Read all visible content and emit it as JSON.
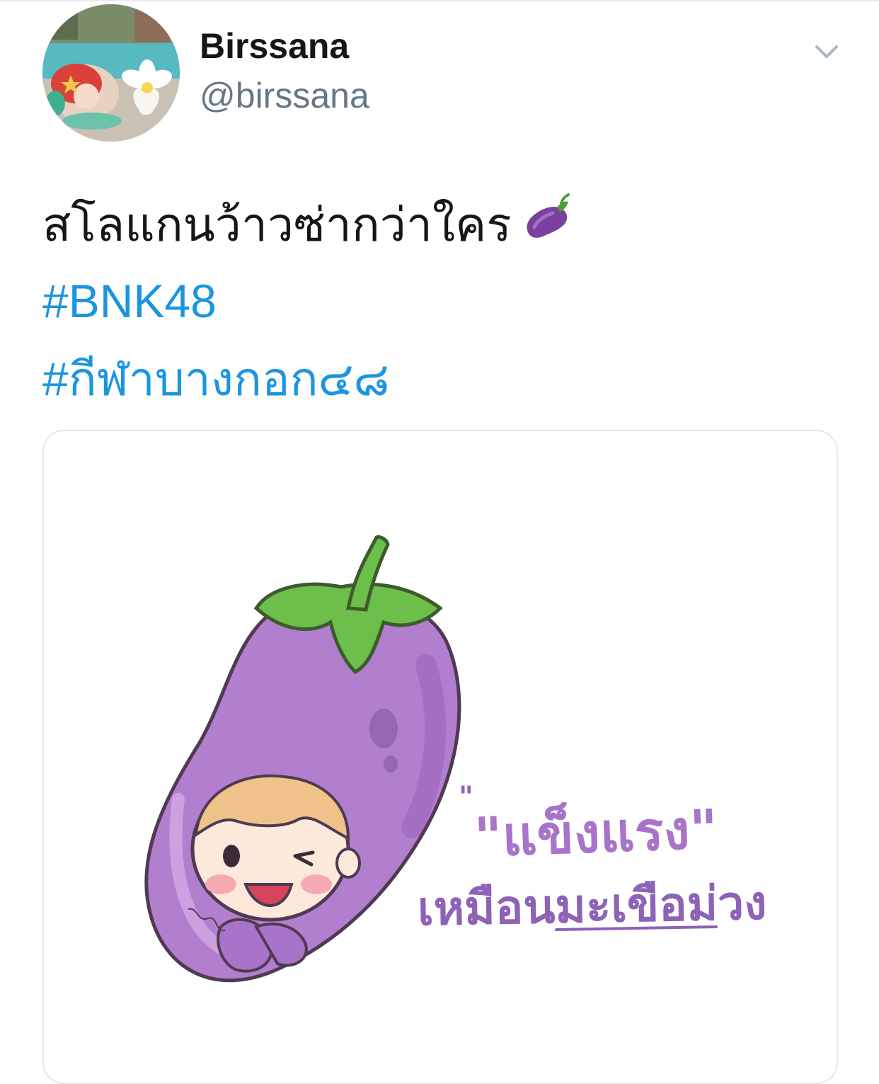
{
  "tweet": {
    "author": {
      "display_name": "Birssana",
      "handle": "@birssana",
      "avatar_icon": "avatar-photo-mermaid-plush"
    },
    "menu_icon": "chevron-down-icon",
    "text": "สโลแกนว้าวซ่ากว่าใคร",
    "text_emoji": "eggplant-emoji",
    "hashtags": [
      "#BNK48",
      "#กีฬาบางกอก๔๘"
    ],
    "media": {
      "type": "illustration",
      "caption_line_1": "\"แข็งแรง\"",
      "caption_line_2": "เหมือนมะเขือม่วง"
    }
  },
  "colors": {
    "text": "#14171a",
    "secondary": "#657786",
    "link": "#1b95e0",
    "border": "#e1e8ed",
    "eggplant": "#a874c9",
    "leaf": "#6cbf4a"
  }
}
